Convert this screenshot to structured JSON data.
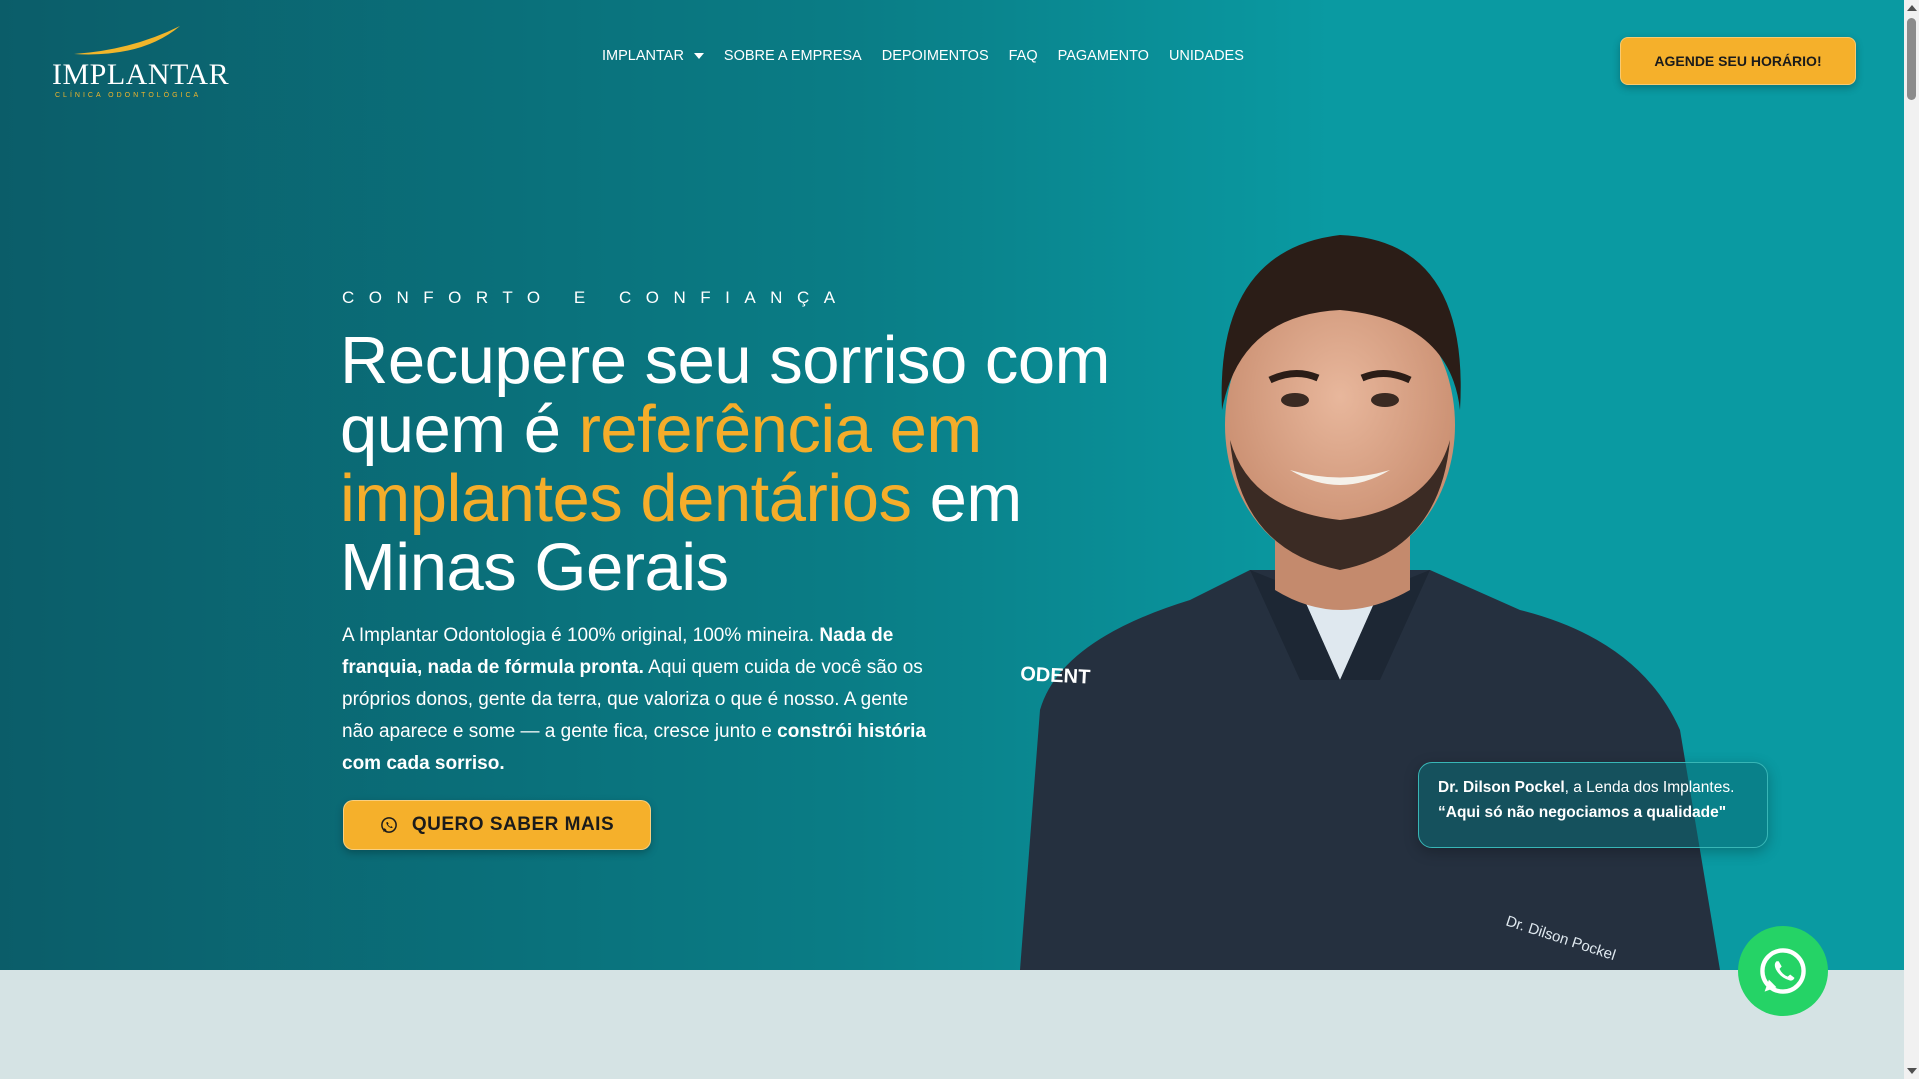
{
  "logo": {
    "wordmark": "IMPLANTAR",
    "tagline": "CLÍNICA ODONTOLÓGICA"
  },
  "nav": {
    "items": [
      "IMPLANTAR",
      "SOBRE A EMPRESA",
      "DEPOIMENTOS",
      "FAQ",
      "PAGAMENTO",
      "UNIDADES"
    ],
    "cta": "AGENDE SEU HORÁRIO!"
  },
  "hero": {
    "eyebrow": "CONFORTO E CONFIANÇA",
    "headline": {
      "part1": "Recupere seu sorriso com quem é ",
      "accent": "referência em implantes dentários",
      "part2": " em Minas Gerais"
    },
    "paragraph": {
      "t1": "A Implantar Odontologia é 100% original, 100% mineira. ",
      "b1": "Nada de franquia, nada de fórmula pronta.",
      "t2": " Aqui quem cuida de você são os próprios donos, gente da terra, que valoriza o que é nosso. A gente não aparece e some — a gente fica, cresce junto e ",
      "b2": "constrói história com cada sorriso."
    },
    "cta": "QUERO SABER MAIS"
  },
  "quote_card": {
    "name": "Dr. Dilson Pockel",
    "title": ", a Lenda dos Implantes.",
    "quote": "“Aqui só não negociamos a qualidade\""
  },
  "jacket": {
    "brand": "ODENT",
    "nametag": "Dr. Dilson Pockel"
  },
  "icons": {
    "whatsapp": "whatsapp-icon",
    "caret": "chevron-down-icon"
  },
  "colors": {
    "accent": "#f5ad2a",
    "button": "#f5b02b",
    "hero_teal": "#0a9aa2",
    "whatsapp": "#25d366",
    "below_bg": "#d5e3e4"
  }
}
